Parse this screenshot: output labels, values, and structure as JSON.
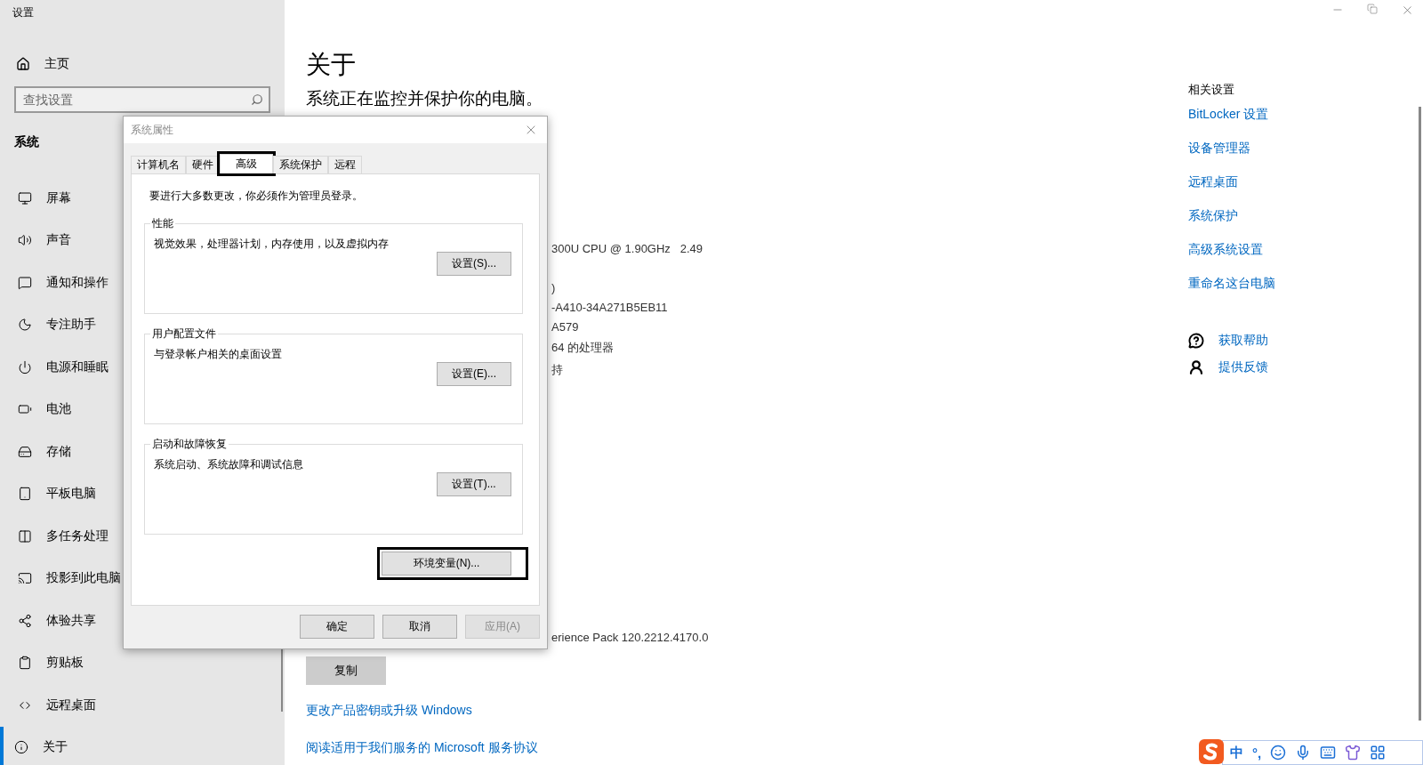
{
  "window": {
    "title": "设置"
  },
  "sidebar": {
    "home": "主页",
    "search": {
      "placeholder": "查找设置"
    },
    "section": "系统",
    "items": [
      {
        "label": "屏幕",
        "selected": false
      },
      {
        "label": "声音",
        "selected": false
      },
      {
        "label": "通知和操作",
        "selected": false
      },
      {
        "label": "专注助手",
        "selected": false
      },
      {
        "label": "电源和睡眠",
        "selected": false
      },
      {
        "label": "电池",
        "selected": false
      },
      {
        "label": "存储",
        "selected": false
      },
      {
        "label": "平板电脑",
        "selected": false
      },
      {
        "label": "多任务处理",
        "selected": false
      },
      {
        "label": "投影到此电脑",
        "selected": false
      },
      {
        "label": "体验共享",
        "selected": false
      },
      {
        "label": "剪贴板",
        "selected": false
      },
      {
        "label": "远程桌面",
        "selected": false
      },
      {
        "label": "关于",
        "selected": true
      }
    ]
  },
  "main": {
    "title": "关于",
    "subtitle": "系统正在监控并保护你的电脑。",
    "specs": [
      "300U CPU @ 1.90GHz   2.49",
      ")",
      "-A410-34A271B5EB11",
      "A579",
      "64 的处理器",
      "持"
    ],
    "version": "erience Pack 120.2212.4170.0",
    "copy_button": "复制",
    "links": [
      "更改产品密钥或升级 Windows",
      "阅读适用于我们服务的 Microsoft 服务协议"
    ]
  },
  "related": {
    "heading": "相关设置",
    "links": [
      "BitLocker 设置",
      "设备管理器",
      "远程桌面",
      "系统保护",
      "高级系统设置",
      "重命名这台电脑"
    ],
    "help": [
      {
        "label": "获取帮助",
        "kind": "help"
      },
      {
        "label": "提供反馈",
        "kind": "feedback"
      }
    ]
  },
  "dialog": {
    "title": "系统属性",
    "tabs": [
      {
        "label": "计算机名",
        "selected": false
      },
      {
        "label": "硬件",
        "selected": false
      },
      {
        "label": "高级",
        "selected": true,
        "highlighted": true
      },
      {
        "label": "系统保护",
        "selected": false
      },
      {
        "label": "远程",
        "selected": false
      }
    ],
    "note": "要进行大多数更改，你必须作为管理员登录。",
    "groups": [
      {
        "title": "性能",
        "text": "视觉效果，处理器计划，内存使用，以及虚拟内存",
        "button": "设置(S)..."
      },
      {
        "title": "用户配置文件",
        "text": "与登录帐户相关的桌面设置",
        "button": "设置(E)..."
      },
      {
        "title": "启动和故障恢复",
        "text": "系统启动、系统故障和调试信息",
        "button": "设置(T)..."
      }
    ],
    "env_button": {
      "label": "环境变量(N)...",
      "highlighted": true
    },
    "buttons": [
      {
        "label": "确定",
        "disabled": false
      },
      {
        "label": "取消",
        "disabled": false
      },
      {
        "label": "应用(A)",
        "disabled": true
      }
    ]
  },
  "ime_bar": {
    "items": [
      {
        "kind": "logo"
      },
      {
        "kind": "text",
        "label": "中"
      },
      {
        "kind": "text",
        "label": "°,"
      },
      {
        "kind": "emoji"
      },
      {
        "kind": "mic"
      },
      {
        "kind": "keyboard"
      },
      {
        "kind": "skin"
      },
      {
        "kind": "apps"
      }
    ]
  }
}
